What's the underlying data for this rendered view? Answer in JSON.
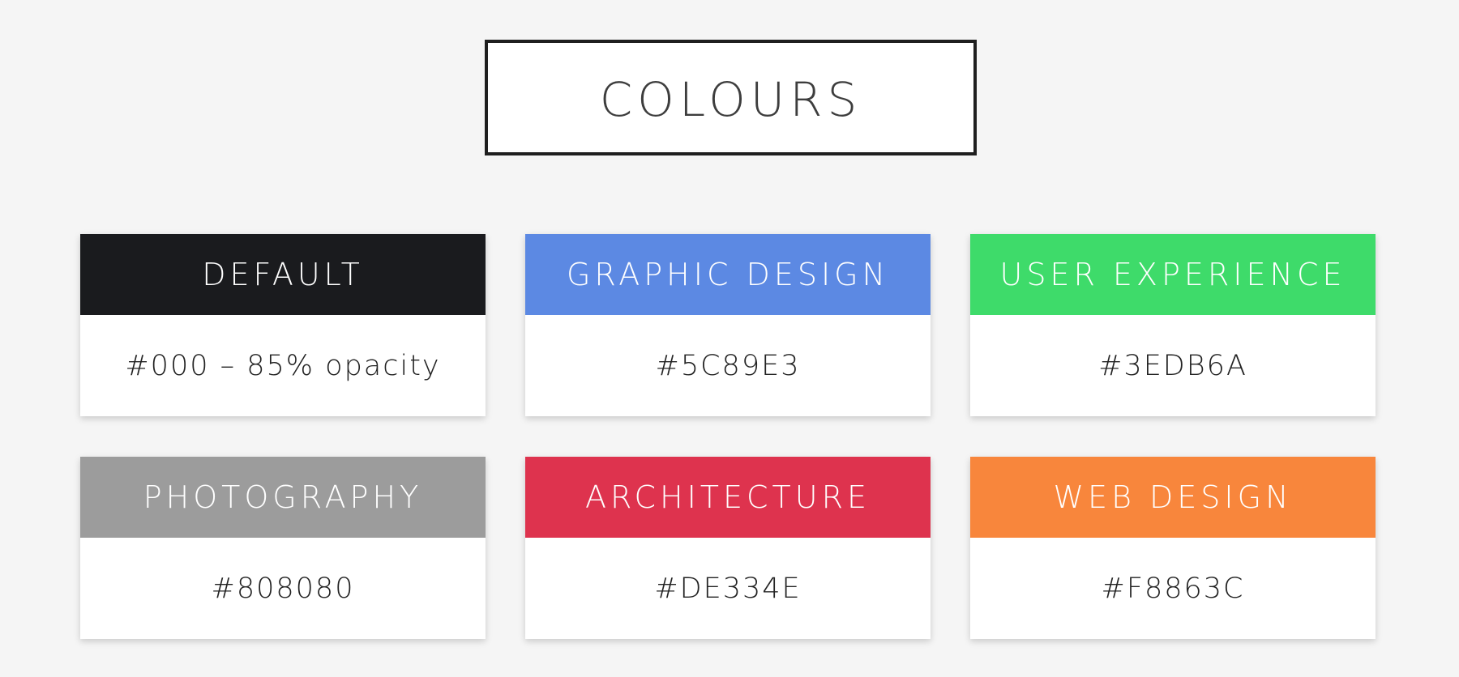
{
  "title": "COLOURS",
  "cards": [
    {
      "name": "DEFAULT",
      "value": "#000 – 85% opacity",
      "color": "#1a1b1e"
    },
    {
      "name": "GRAPHIC DESIGN",
      "value": "#5C89E3",
      "color": "#5c89e3"
    },
    {
      "name": "USER EXPERIENCE",
      "value": "#3EDB6A",
      "color": "#3edb6a"
    },
    {
      "name": "PHOTOGRAPHY",
      "value": "#808080",
      "color": "#9c9c9c"
    },
    {
      "name": "ARCHITECTURE",
      "value": "#DE334E",
      "color": "#de334e"
    },
    {
      "name": "WEB DESIGN",
      "value": "#F8863C",
      "color": "#f8863c"
    }
  ]
}
